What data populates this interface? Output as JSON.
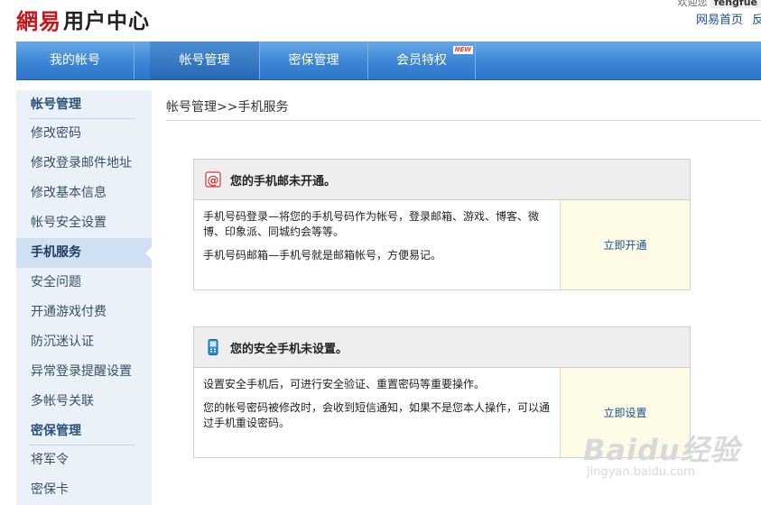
{
  "header": {
    "logo_brand": "網易",
    "logo_title": "用户中心",
    "user_prefix": "欢迎您",
    "user_name": "fengfue",
    "links": [
      "网易首页",
      "反"
    ]
  },
  "nav": {
    "items": [
      {
        "label": "我的帐号"
      },
      {
        "label": "帐号管理"
      },
      {
        "label": "密保管理"
      },
      {
        "label": "会员特权",
        "badge": "NEW"
      }
    ],
    "active": "帐号管理"
  },
  "sidebar": {
    "section1": "帐号管理",
    "items1": [
      "修改密码",
      "修改登录邮件地址",
      "修改基本信息",
      "帐号安全设置",
      "手机服务",
      "安全问题",
      "开通游戏付费",
      "防沉迷认证",
      "异常登录提醒设置",
      "多帐号关联"
    ],
    "section2": "密保管理",
    "items2": [
      "将军令",
      "密保卡"
    ],
    "active": "手机服务"
  },
  "breadcrumb": "帐号管理>>手机服务",
  "cards": [
    {
      "icon": "at-mail-icon",
      "title": "您的手机邮未开通。",
      "para1": "手机号码登录—将您的手机号码作为帐号，登录邮箱、游戏、博客、微博、印象派、同城约会等等。",
      "para2": "手机号码邮箱—手机号就是邮箱帐号，方便易记。",
      "action": "立即开通"
    },
    {
      "icon": "mobile-phone-icon",
      "title": "您的安全手机未设置。",
      "para1": "设置安全手机后，可进行安全验证、重置密码等重要操作。",
      "para2": "您的帐号密码被修改时，会收到短信通知，如果不是您本人操作，可以通过手机重设密码。",
      "action": "立即设置"
    }
  ],
  "watermark": {
    "main": "Baidu经验",
    "sub": "jingyan.baidu.com"
  },
  "colors": {
    "brand_red": "#c4161c",
    "nav_blue": "#3c86d6",
    "link_blue": "#1a4f8a",
    "action_bg": "#fdfbe6"
  }
}
